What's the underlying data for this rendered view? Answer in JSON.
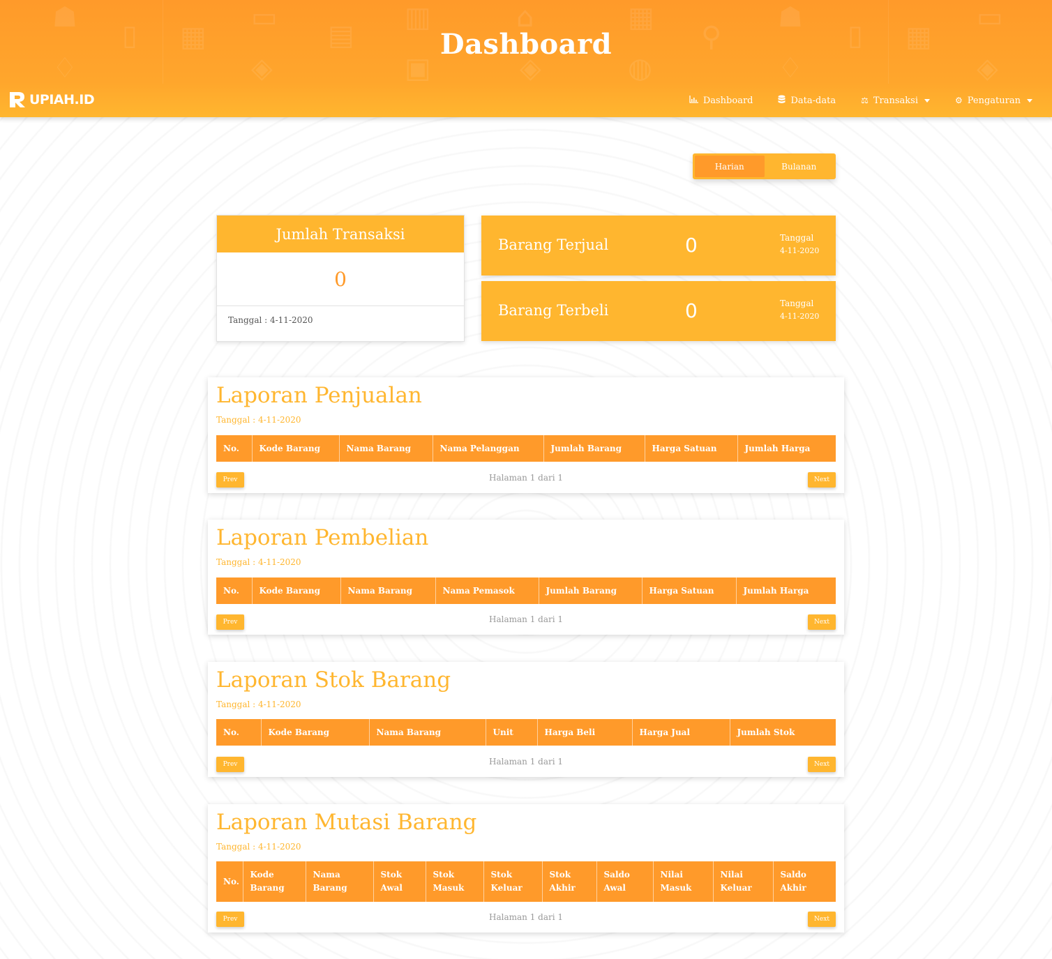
{
  "header": {
    "title": "Dashboard"
  },
  "navbar": {
    "brand": "UPIAH.ID",
    "items": [
      {
        "label": "Dashboard",
        "icon": "chart-icon",
        "dropdown": false
      },
      {
        "label": "Data-data",
        "icon": "database-icon",
        "dropdown": false
      },
      {
        "label": "Transaksi",
        "icon": "scale-icon",
        "dropdown": true
      },
      {
        "label": "Pengaturan",
        "icon": "gear-icon",
        "dropdown": true
      }
    ]
  },
  "period_toggle": {
    "options": [
      "Harian",
      "Bulanan"
    ],
    "selected": "Harian"
  },
  "jumlah_transaksi": {
    "title": "Jumlah Transaksi",
    "value": "0",
    "footer": "Tanggal : 4-11-2020"
  },
  "barang_terjual": {
    "label": "Barang Terjual",
    "value": "0",
    "date_label": "Tanggal",
    "date": "4-11-2020"
  },
  "barang_terbeli": {
    "label": "Barang Terbeli",
    "value": "0",
    "date_label": "Tanggal",
    "date": "4-11-2020"
  },
  "reports": {
    "penjualan": {
      "title": "Laporan Penjualan",
      "date": "Tanggal : 4-11-2020",
      "columns": [
        "No.",
        "Kode Barang",
        "Nama Barang",
        "Nama Pelanggan",
        "Jumlah Barang",
        "Harga Satuan",
        "Jumlah Harga"
      ],
      "prev": "Prev",
      "next": "Next",
      "page_info": "Halaman 1 dari 1"
    },
    "pembelian": {
      "title": "Laporan Pembelian",
      "date": "Tanggal : 4-11-2020",
      "columns": [
        "No.",
        "Kode Barang",
        "Nama Barang",
        "Nama Pemasok",
        "Jumlah Barang",
        "Harga Satuan",
        "Jumlah Harga"
      ],
      "prev": "Prev",
      "next": "Next",
      "page_info": "Halaman 1 dari 1"
    },
    "stok": {
      "title": "Laporan Stok Barang",
      "date": "Tanggal : 4-11-2020",
      "columns": [
        "No.",
        "Kode Barang",
        "Nama Barang",
        "Unit",
        "Harga Beli",
        "Harga Jual",
        "Jumlah Stok"
      ],
      "prev": "Prev",
      "next": "Next",
      "page_info": "Halaman 1 dari 1"
    },
    "mutasi": {
      "title": "Laporan Mutasi Barang",
      "date": "Tanggal : 4-11-2020",
      "columns": [
        "No.",
        "Kode Barang",
        "Nama Barang",
        "Stok Awal",
        "Stok Masuk",
        "Stok Keluar",
        "Stok Akhir",
        "Saldo Awal",
        "Nilai Masuk",
        "Nilai Keluar",
        "Saldo Akhir"
      ],
      "prev": "Prev",
      "next": "Next",
      "page_info": "Halaman 1 dari 1"
    }
  },
  "colors": {
    "primary": "#ff9a2a",
    "accent": "#ffb62f",
    "text_muted": "#999999"
  }
}
